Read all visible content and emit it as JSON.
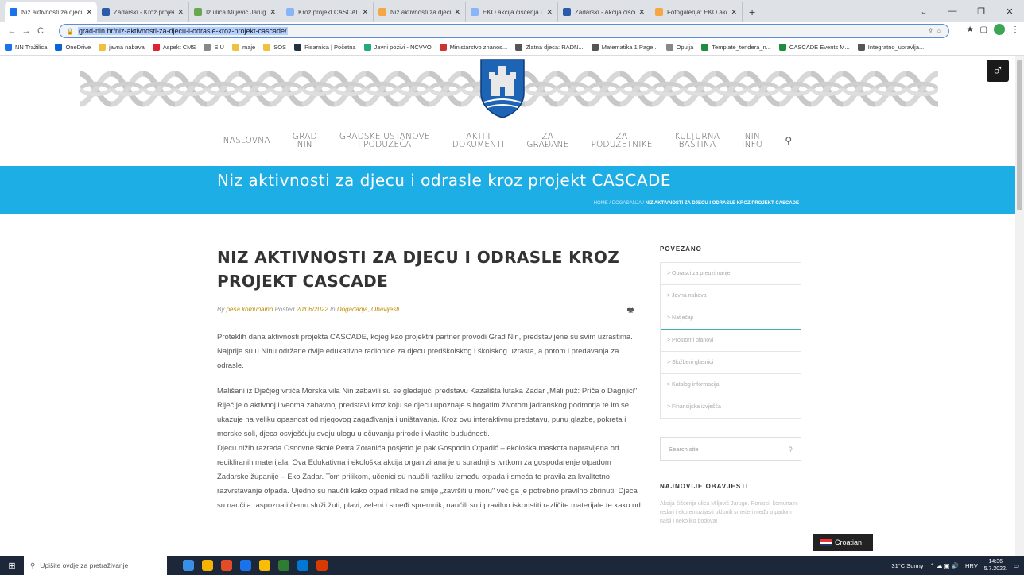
{
  "browser": {
    "tabs": [
      {
        "title": "Niz aktivnosti za djecu i od",
        "color": "#1a73e8",
        "active": true
      },
      {
        "title": "Zadarski - Kroz projekt 'Ca",
        "color": "#2b5caa"
      },
      {
        "title": "Iz ulica Miljević Jaruge sr...",
        "color": "#6aa84f"
      },
      {
        "title": "Kroz projekt CASCADE ost",
        "color": "#8ab4f8"
      },
      {
        "title": "Niz aktivnosti za djecu i od",
        "color": "#f4a742"
      },
      {
        "title": "EKO akcija čišćenja ulica M",
        "color": "#8ab4f8"
      },
      {
        "title": "Zadarski - Akcija čišćenja",
        "color": "#2b5caa"
      },
      {
        "title": "Fotogalerija: EKO akcija či",
        "color": "#f4a742"
      }
    ],
    "tab_close": "✕",
    "new_tab": "+",
    "window_controls": {
      "dropdown": "⌄",
      "minimize": "—",
      "maximize": "❐",
      "close": "✕"
    },
    "nav": {
      "back": "←",
      "forward": "→",
      "reload": "C"
    },
    "url": "grad-nin.hr/niz-aktivnosti-za-djecu-i-odrasle-kroz-projekt-cascade/",
    "url_icons": "⇪  ☆",
    "ext_icons": [
      "★",
      "▢"
    ],
    "menu_icon": "⋮",
    "bookmarks": [
      {
        "label": "NN Tražilica",
        "color": "#1a73e8"
      },
      {
        "label": "OneDrive",
        "color": "#0a64d6"
      },
      {
        "label": "javna nabava",
        "color": "#f0c040"
      },
      {
        "label": "Aspekt CMS",
        "color": "#d23"
      },
      {
        "label": "SIU",
        "color": "#888"
      },
      {
        "label": "maje",
        "color": "#f0c040"
      },
      {
        "label": "SOS",
        "color": "#f0c040"
      },
      {
        "label": "Pisarnica | Početna",
        "color": "#234"
      },
      {
        "label": "Javni pozivi - NCVVO",
        "color": "#2a7"
      },
      {
        "label": "Ministarstvo znanos...",
        "color": "#c33"
      },
      {
        "label": "Zlatna djeca: RADN...",
        "color": "#555"
      },
      {
        "label": "Matematika 1 Page...",
        "color": "#555"
      },
      {
        "label": "Opulja",
        "color": "#888"
      },
      {
        "label": "Template_tendera_n...",
        "color": "#1e8e3e"
      },
      {
        "label": "CASCADE Events M...",
        "color": "#1e8e3e"
      },
      {
        "label": "Integratno_upravlja...",
        "color": "#555"
      }
    ]
  },
  "site": {
    "accessibility_icon": "♂",
    "menu": [
      {
        "line1": "NASLOVNA",
        "line2": ""
      },
      {
        "line1": "GRAD",
        "line2": "NIN"
      },
      {
        "line1": "GRADSKE USTANOVE",
        "line2": "I PODUZEĆA"
      },
      {
        "line1": "AKTI I",
        "line2": "DOKUMENTI"
      },
      {
        "line1": "ZA",
        "line2": "GRAĐANE"
      },
      {
        "line1": "ZA",
        "line2": "PODUZETNIKE"
      },
      {
        "line1": "KULTURNA",
        "line2": "BAŠTINA"
      },
      {
        "line1": "NIN",
        "line2": "INFO"
      }
    ],
    "search_icon": "⚲",
    "band_title": "Niz aktivnosti za djecu i odrasle kroz projekt CASCADE",
    "breadcrumb": {
      "home": "HOME",
      "cat": "DOGAĐANJA",
      "current": "NIZ AKTIVNOSTI ZA DJECU I ODRASLE KROZ PROJEKT CASCADE",
      "sep": " / "
    },
    "article": {
      "title": "NIZ AKTIVNOSTI ZA DJECU I ODRASLE KROZ PROJEKT CASCADE",
      "by": "By",
      "author": "pesa komunalno",
      "posted": "Posted",
      "date": "20/06/2022",
      "in": "In",
      "categories": "Događanja, Obavijesti",
      "print_icon": "🖶",
      "p1": "Proteklih dana aktivnosti projekta CASCADE, kojeg kao projektni partner provodi Grad Nin, predstavljene su svim uzrastima. Najprije su u Ninu održane dvije edukativne radionice za djecu predškolskog i školskog uzrasta, a potom i predavanja za odrasle.",
      "p2": "Mališani iz Dječjeg vrtića Morska vila Nin zabavili su se gledajući predstavu Kazališta lutaka Zadar „Mali puž: Priča o Dagnjici\". Riječ je o aktivnoj i veoma zabavnoj predstavi kroz koju se djecu upoznaje s bogatim životom jadranskog podmorja te im se ukazuje na veliku opasnost od njegovog zagađivanja i uništavanja. Kroz ovu interaktivnu predstavu, punu glazbe, pokreta i morske soli, djeca osvješćuju svoju ulogu u očuvanju prirode i vlastite budućnosti.",
      "p3": "Djecu nižih razreda Osnovne škole Petra Zoranića posjetio je pak Gospodin Otpadić – ekološka maskota napravljena od recikliranih materijala. Ova Edukativna i ekološka akcija organizirana je u suradnji s tvrtkom za gospodarenje otpadom Zadarske županije – Eko Zadar. Tom prilikom, učenici su naučili razliku između otpada i smeća te pravila za kvalitetno razvrstavanje otpada. Ujedno su naučili kako otpad nikad ne smije „završiti u moru\" već ga je potrebno pravilno zbrinuti. Djeca su naučila raspoznati čemu služi žuti, plavi, zeleni i smeđi spremnik, naučili su i pravilno iskoristiti različite materijale te kako od"
    },
    "sidebar": {
      "related_title": "POVEZANO",
      "links": [
        "> Obrasci za preuzimanje",
        "> Javna nabava",
        "> Natječaji",
        "> Prostorni planovi",
        "> Službeni glasnici",
        "> Katalog informacija",
        "> Financijska izvješća"
      ],
      "search_placeholder": "Search site",
      "search_icon": "⚲",
      "news_title": "NAJNOVIJE OBAVJESTI",
      "news_text": "Akcija čišćenja ulica Miljević Jaruge. Ronioci, komunalni redari i eko entuzijasti uklonili smeće i među otpadom našli i nekoliko bodova!"
    },
    "language": "Croatian"
  },
  "taskbar": {
    "start_icon": "⊞",
    "search_placeholder": "Upišite ovdje za pretraživanje",
    "search_icon": "⚲",
    "apps": [
      "#3a8ee6",
      "#f4b400",
      "#e34c26",
      "#1a73e8",
      "#fbbc05",
      "#2e7d32",
      "#0078d4",
      "#d83b01"
    ],
    "weather": "31°C Sunny",
    "lang": "HRV",
    "time": "14:36",
    "date": "5.7.2022."
  }
}
